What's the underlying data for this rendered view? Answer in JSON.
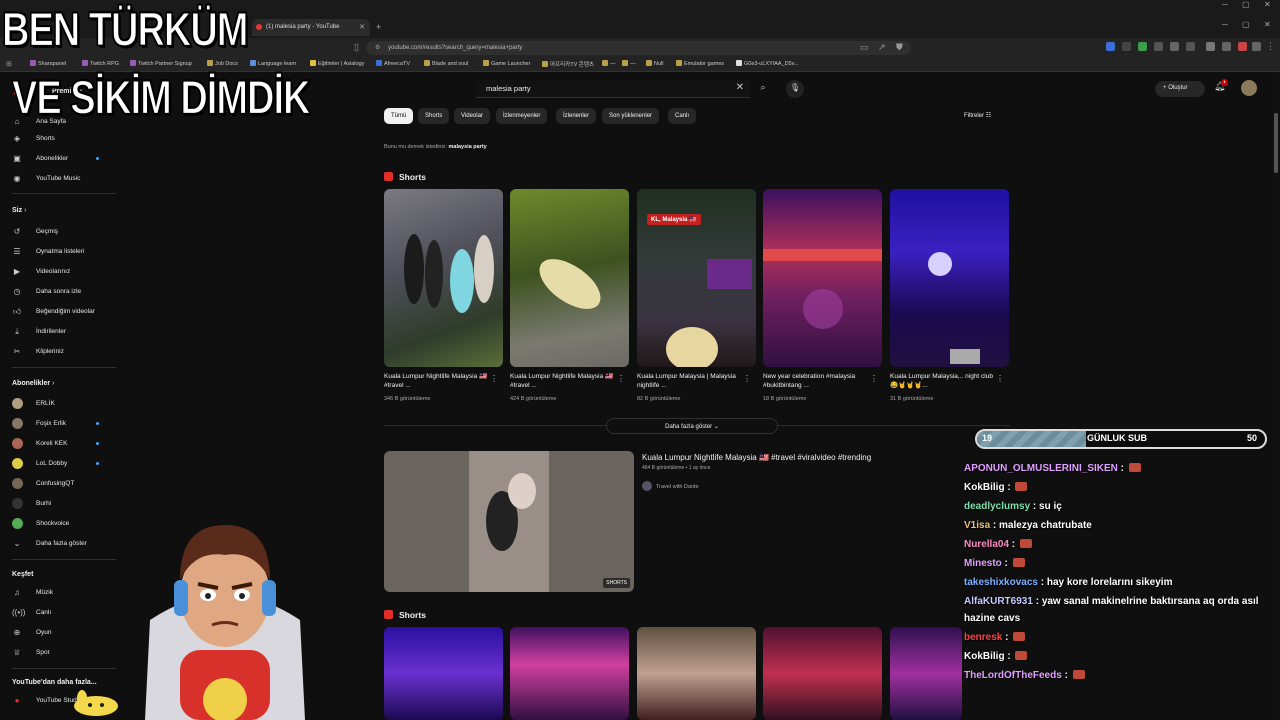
{
  "browser": {
    "tab_title": "(1) malesia party - YouTube",
    "url": "youtube.com/results?search_query=malesia+party",
    "bookmarks": [
      "Sharapanel",
      "Twitch RPG",
      "Twitch Partner Signup",
      "Job Docs",
      "Language learn",
      "Eğitimler | Asialogy",
      "AfreecaTV",
      "Blade and soul",
      "Game Launcher",
      "아프리카TV 콘텐츠",
      "—",
      "—",
      "Null",
      "Emulator games",
      "G0e3-uLXYIAA_D5v..."
    ]
  },
  "overlay": {
    "line1": "BEN TÜRKÜM",
    "line2": "VE SİKİM DİMDİK"
  },
  "sidebar": {
    "logo_text": "Premium",
    "items_main": [
      {
        "icon": "home-icon",
        "label": "Ana Sayfa"
      },
      {
        "icon": "shorts-icon",
        "label": "Shorts"
      },
      {
        "icon": "subscriptions-icon",
        "label": "Abonelikler"
      },
      {
        "icon": "music-icon",
        "label": "YouTube Music"
      }
    ],
    "you_header": "Siz",
    "items_you": [
      {
        "icon": "history-icon",
        "label": "Geçmiş"
      },
      {
        "icon": "playlist-icon",
        "label": "Oynatma listeleri"
      },
      {
        "icon": "video-icon",
        "label": "Videolarınız"
      },
      {
        "icon": "clock-icon",
        "label": "Daha sonra izle"
      },
      {
        "icon": "like-icon",
        "label": "Beğendiğim videolar"
      },
      {
        "icon": "download-icon",
        "label": "İndirilenler"
      },
      {
        "icon": "clip-icon",
        "label": "Klipleriniz"
      }
    ],
    "subs_header": "Abonelikler",
    "subs": [
      {
        "label": "ERLİK",
        "color": "#b0a080"
      },
      {
        "label": "Foşix Erlik",
        "color": "#887766"
      },
      {
        "label": "Koreli KEK",
        "color": "#aa6655"
      },
      {
        "label": "LoL Dobby",
        "color": "#ddcc44"
      },
      {
        "label": "ConfusingQT",
        "color": "#776655"
      },
      {
        "label": "Burhi",
        "color": "#333333"
      },
      {
        "label": "Shockvoice",
        "color": "#55aa55"
      },
      {
        "label": "Daha fazla göster",
        "color": ""
      }
    ],
    "explore_header": "Keşfet",
    "items_explore": [
      {
        "icon": "music-note-icon",
        "label": "Müzik"
      },
      {
        "icon": "live-icon",
        "label": "Canlı"
      },
      {
        "icon": "gaming-icon",
        "label": "Oyun"
      },
      {
        "icon": "trophy-icon",
        "label": "Spor"
      }
    ],
    "more_header": "YouTube'dan daha fazla...",
    "more_item": "YouTube Studio"
  },
  "topbar": {
    "search_value": "malesia party",
    "create_label": "Oluştur",
    "bell_count": "1"
  },
  "chips": [
    "Tümü",
    "Shorts",
    "Videolar",
    "İzlenmeyenler",
    "İzlenenler",
    "Son yüklenenler",
    "Canlı"
  ],
  "filters_label": "Filtreler",
  "did_you_mean": {
    "prefix": "Bunu mu demek istediniz:",
    "query": "malaysia party"
  },
  "shelf1": {
    "title": "Shorts",
    "items": [
      {
        "title": "Kuala Lumpur Nightlife Malaysia 🇲🇾#travel ...",
        "views": "346 B görüntüleme",
        "badge": ""
      },
      {
        "title": "Kuala Lumpur Nightlife Malaysia 🇲🇾 #travel ...",
        "views": "424 B görüntüleme",
        "badge": ""
      },
      {
        "title": "Kuala Lumpur Malaysia | Malaysia nightlife ...",
        "views": "82 B görüntüleme",
        "badge": "KL, Malaysia 🇲🇾"
      },
      {
        "title": "New year celebration #malaysia #bukitbintang ...",
        "views": "18 B görüntüleme",
        "badge": ""
      },
      {
        "title": "Kuala Lumpur Malaysia,.. night club 😂🤘🤘🤘...",
        "views": "31 B görüntüleme",
        "badge": ""
      }
    ],
    "more_label": "Daha fazla göster"
  },
  "video": {
    "title": "Kuala Lumpur Nightlife Malaysia 🇲🇾 #travel #viralvideo #trending",
    "meta": "464 B görüntüleme • 1 ay önce",
    "channel": "Travel with Dante",
    "tag": "SHORTS"
  },
  "shelf2": {
    "title": "Shorts"
  },
  "goal": {
    "label": "GÜNLUK SUB",
    "current": 19,
    "target": 50,
    "current_text": "19",
    "target_text": "50"
  },
  "chat": [
    {
      "user": "APONUN_OLMUSLERINI_SIKEN",
      "color": "#e0a0ff",
      "msg": "",
      "emote": true
    },
    {
      "user": "KokBilig",
      "color": "#ffffff",
      "msg": "",
      "emote": true
    },
    {
      "user": "deadlyclumsy",
      "color": "#7fe0b0",
      "msg": "su iç",
      "emote": false
    },
    {
      "user": "V1isa",
      "color": "#e8c070",
      "msg": "malezya chatrubate",
      "emote": false
    },
    {
      "user": "Nurella04",
      "color": "#ff8cc6",
      "msg": "",
      "emote": true
    },
    {
      "user": "Minesto",
      "color": "#e0a0ff",
      "msg": "",
      "emote": true
    },
    {
      "user": "takeshixkovacs",
      "color": "#7fb0ff",
      "msg": "hay kore lorelarını sikeyim",
      "emote": false
    },
    {
      "user": "AlfaKURT6931",
      "color": "#c8c8ff",
      "msg": "yaw sanal makinelrine baktırsana aq orda asıl",
      "emote": false
    },
    {
      "user": "",
      "color": "#ffffff",
      "msg": "hazine cavs",
      "emote": false
    },
    {
      "user": "benresk",
      "color": "#ff4040",
      "msg": "",
      "emote": true
    },
    {
      "user": "KokBilig",
      "color": "#ffffff",
      "msg": "",
      "emote": true
    },
    {
      "user": "TheLordOfTheFeeds",
      "color": "#e0a0ff",
      "msg": "",
      "emote": true
    }
  ]
}
